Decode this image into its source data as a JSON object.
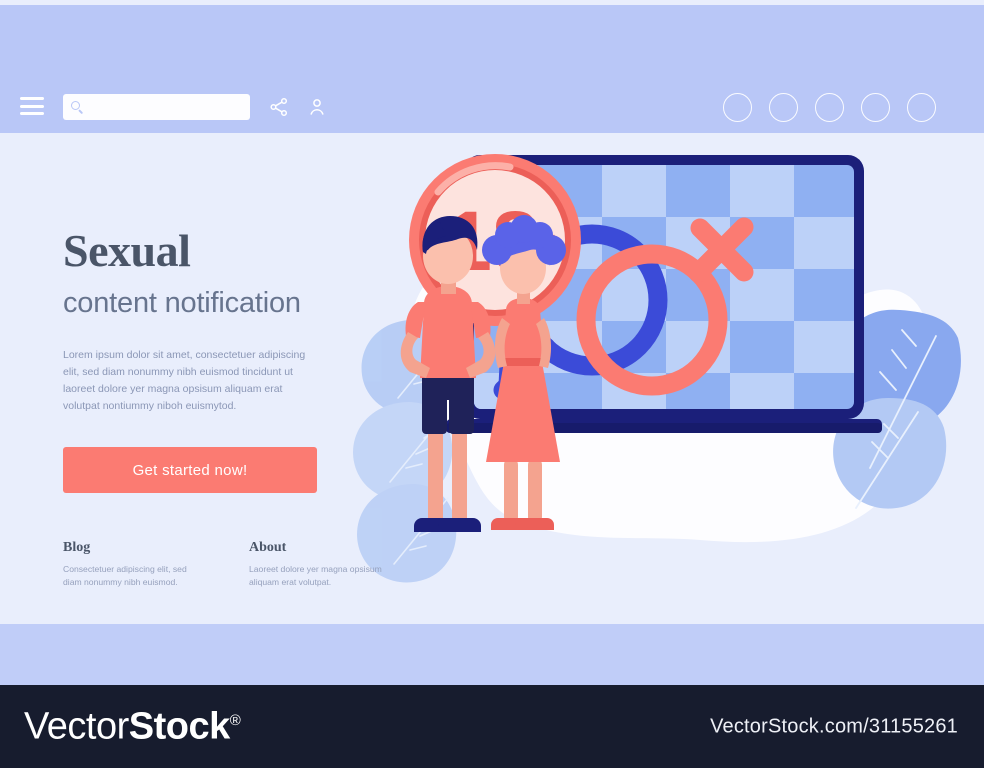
{
  "colors": {
    "header_band": "#b9c7f7",
    "page_bg": "#e9eefc",
    "bottom_band": "#c0cdf8",
    "accent_coral": "#fb7b72",
    "accent_blue": "#3b4bd8",
    "navy": "#1b1f7a",
    "watermark_bar": "#171c2e",
    "heading_text": "#4a5568",
    "body_text": "#8b97b6"
  },
  "header": {
    "menu_label": "Menu",
    "search": {
      "value": "",
      "placeholder": ""
    },
    "icons": [
      "hamburger-icon",
      "search-icon",
      "share-icon",
      "user-icon"
    ],
    "nav_circles": [
      {
        "label": ""
      },
      {
        "label": ""
      },
      {
        "label": ""
      },
      {
        "label": ""
      },
      {
        "label": ""
      }
    ]
  },
  "hero": {
    "title_main": "Sexual",
    "title_sub": "content notification",
    "lead": "Lorem ipsum dolor sit amet, consectetuer adipiscing elit, sed diam nonummy nibh euismod tincidunt ut laoreet dolore yer magna opsisum aliquam erat volutpat nontiummy niboh euismytod.",
    "cta_label": "Get started now!"
  },
  "link_columns": [
    {
      "heading": "Blog",
      "text": "Consectetuer adipiscing elit, sed diam nonummy nibh euismod."
    },
    {
      "heading": "About",
      "text": "Laoreet dolore yer magna opsisum aliquam erat volutpat."
    }
  ],
  "illustration": {
    "badge_text": "18+",
    "elements": [
      "age-rating-badge",
      "laptop-device",
      "male-gender-symbol",
      "female-gender-symbol",
      "boy-character",
      "girl-character",
      "leaf-decoration",
      "document-stack"
    ]
  },
  "watermark": {
    "logo_thin": "Vector",
    "logo_bold": "Stock",
    "logo_registered": "®",
    "url": "VectorStock.com/31155261"
  }
}
